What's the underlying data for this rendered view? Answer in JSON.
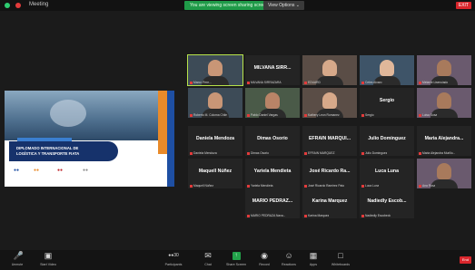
{
  "topbar": {
    "meeting_label": "Meeting",
    "sharing_label": "You are viewing screen sharing screen",
    "view_options_label": "View Options ⌄",
    "exit_label": "EXIT"
  },
  "slide": {
    "line1": "DIPLOMADO INTERNACIONAL DE",
    "line2": "LOGÍSTICA Y TRANSPORTE FIATA"
  },
  "participants": [
    {
      "name": "",
      "caption": "Marco Pere...",
      "cam": true,
      "active": true
    },
    {
      "name": "MILVANA  SIRR...",
      "caption": "MILVANA SIRRAZARA",
      "cam": false
    },
    {
      "name": "",
      "caption": "EDUARD",
      "cam": true
    },
    {
      "name": "",
      "caption": "Celes Alvaro",
      "cam": true
    },
    {
      "name": "",
      "caption": "Melanie Lisenciado",
      "cam": true
    },
    {
      "name": "",
      "caption": "Roberto M. Coloma Chile",
      "cam": true
    },
    {
      "name": "",
      "caption": "Pablo Daniel Vargas",
      "cam": true
    },
    {
      "name": "",
      "caption": "Kathery Leon Romanez",
      "cam": true
    },
    {
      "name": "Sergio",
      "caption": "Sergio",
      "cam": false
    },
    {
      "name": "",
      "caption": "Luisa Sosa",
      "cam": true
    },
    {
      "name": "Daniela Mendoza",
      "caption": "Daniela Mendoza",
      "cam": false
    },
    {
      "name": "Dimas Osorio",
      "caption": "Dimas Osorio",
      "cam": false
    },
    {
      "name": "EFRAIN  MARQUI...",
      "caption": "EFRAIN MARQUEZ",
      "cam": false
    },
    {
      "name": "Julio Dominguez",
      "caption": "Julio Dominguez",
      "cam": false
    },
    {
      "name": "Maria  Alejandra...",
      "caption": "Maria Alejandra Murillo...",
      "cam": false
    },
    {
      "name": "Maquell Núñez",
      "caption": "Maquell Núñez",
      "cam": false
    },
    {
      "name": "Yariela Mendieta",
      "caption": "Yariela Mendieta",
      "cam": false
    },
    {
      "name": "José Ricardo  Ra...",
      "caption": "José Ricardo Ramirez Pato",
      "cam": false
    },
    {
      "name": "Luca Luna",
      "caption": "Luca Luna",
      "cam": false
    },
    {
      "name": "",
      "caption": "Ana Rosa",
      "cam": true
    },
    {
      "name": "MARIO  PEDRAZ...",
      "caption": "MARIO PEDRAZA Nava...",
      "cam": false
    },
    {
      "name": "Karina Marquez",
      "caption": "Karina Marquez",
      "cam": false
    },
    {
      "name": "Nadiedly  Escob...",
      "caption": "Nadiedly Escobedo",
      "cam": false
    }
  ],
  "toolbar": {
    "unmute": "Unmute",
    "start_video": "Start Video",
    "participants": "Participants",
    "participants_count": "30",
    "chat": "Chat",
    "share_screen": "Share Screen",
    "record": "Record",
    "reactions": "Reactions",
    "apps": "Apps",
    "whiteboards": "Whiteboards",
    "end": "End"
  },
  "colors": {
    "accent_green": "#22a24a",
    "end_red": "#d9262c",
    "active_speaker": "#b7e34a"
  }
}
